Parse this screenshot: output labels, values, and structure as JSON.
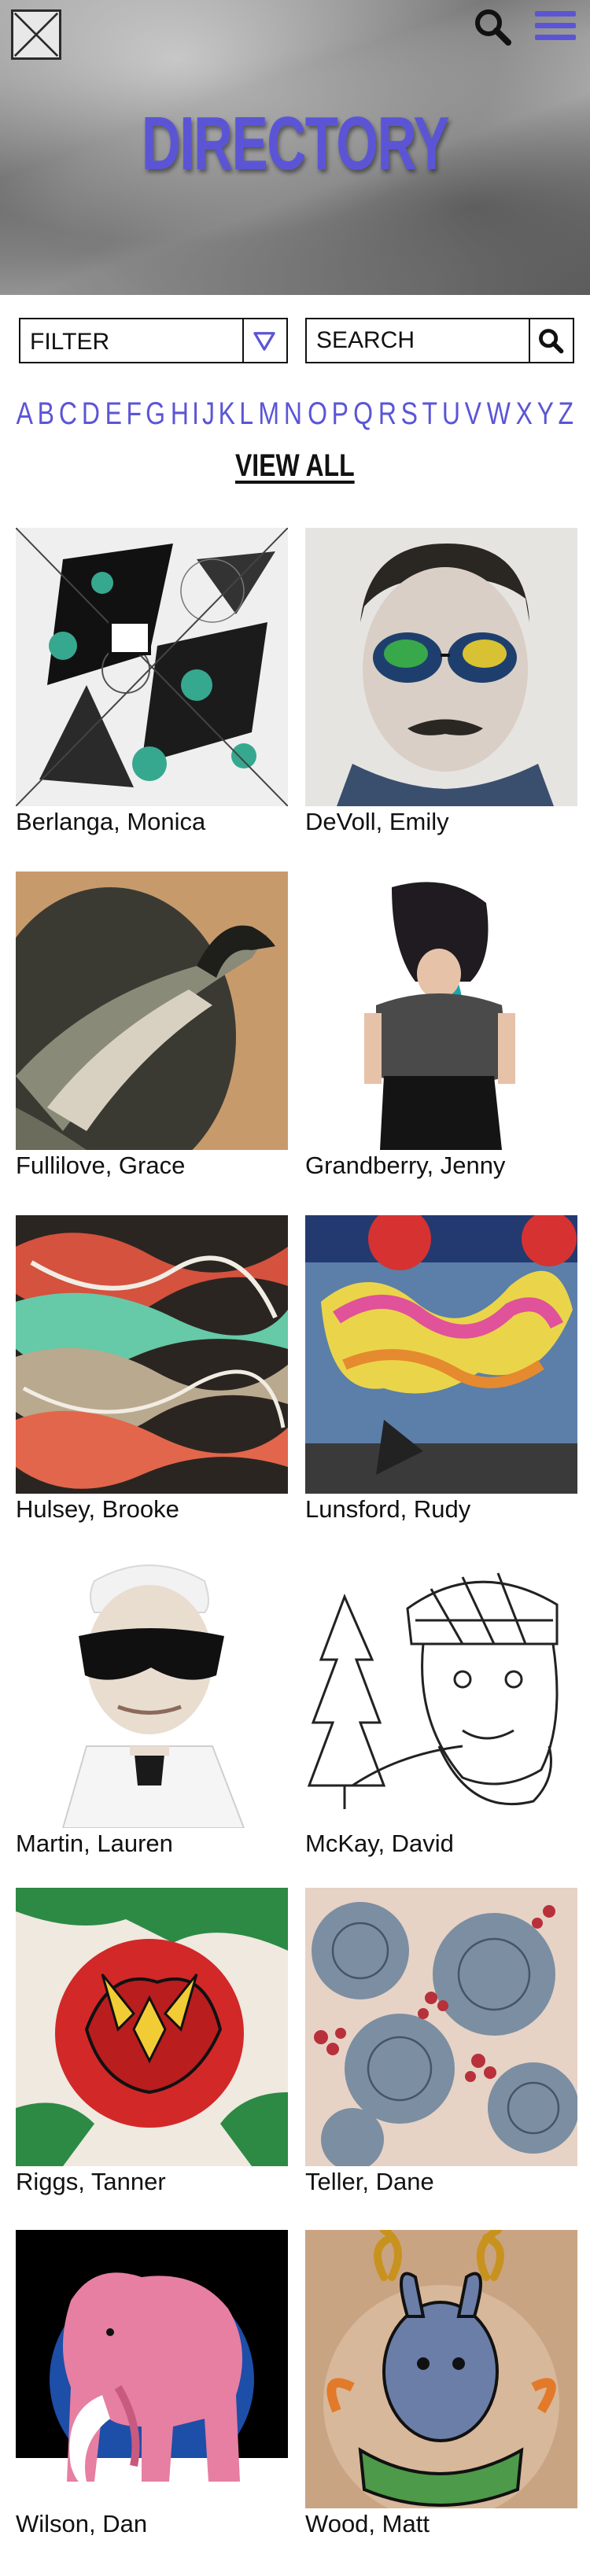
{
  "header": {
    "title": "DIRECTORY",
    "logo_icon": "logo-x-icon",
    "search_icon": "search-icon",
    "menu_icon": "hamburger-menu-icon",
    "accent_color": "#5b55d6"
  },
  "controls": {
    "filter_label": "FILTER",
    "search_placeholder": "SEARCH"
  },
  "alphabet": [
    "A",
    "B",
    "C",
    "D",
    "E",
    "F",
    "G",
    "H",
    "I",
    "J",
    "K",
    "L",
    "M",
    "N",
    "O",
    "P",
    "Q",
    "R",
    "S",
    "T",
    "U",
    "V",
    "W",
    "X",
    "Y",
    "Z"
  ],
  "view_all_label": "VIEW ALL",
  "artists": [
    {
      "name": "Berlanga, Monica"
    },
    {
      "name": "DeVoll, Emily"
    },
    {
      "name": "Fullilove, Grace"
    },
    {
      "name": "Grandberry, Jenny"
    },
    {
      "name": "Hulsey, Brooke"
    },
    {
      "name": "Lunsford, Rudy"
    },
    {
      "name": "Martin, Lauren"
    },
    {
      "name": "McKay, David"
    },
    {
      "name": "Riggs, Tanner"
    },
    {
      "name": "Teller, Dane"
    },
    {
      "name": "Wilson, Dan"
    },
    {
      "name": "Wood, Matt"
    }
  ]
}
